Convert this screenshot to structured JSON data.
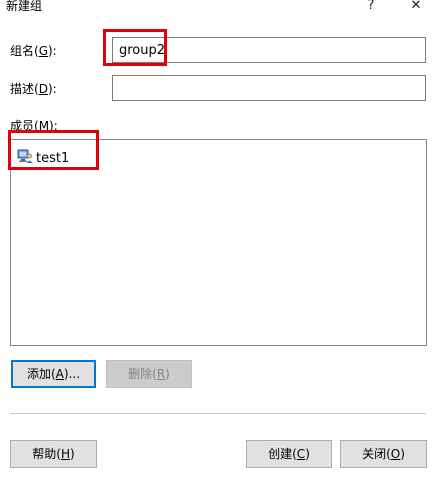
{
  "window": {
    "title": "新建组",
    "help_glyph": "?",
    "close_glyph": "✕"
  },
  "form": {
    "group_name_label": "组名(",
    "group_name_key": "G",
    "group_name_suffix": "):",
    "group_name_value": "group2",
    "description_label": "描述(",
    "description_key": "D",
    "description_suffix": "):",
    "description_value": "",
    "members_label": "成员(",
    "members_key": "M",
    "members_suffix": "):"
  },
  "members": [
    {
      "name": "test1",
      "icon": "user-icon"
    }
  ],
  "buttons": {
    "add": {
      "text": "添加(",
      "key": "A",
      "suffix": ")..."
    },
    "remove": {
      "text": "删除(",
      "key": "R",
      "suffix": ")"
    },
    "help": {
      "text": "帮助(",
      "key": "H",
      "suffix": ")"
    },
    "create": {
      "text": "创建(",
      "key": "C",
      "suffix": ")"
    },
    "close": {
      "text": "关闭(",
      "key": "O",
      "suffix": ")"
    }
  },
  "colors": {
    "highlight": "#e0000a",
    "default_button_border": "#0078d7"
  }
}
